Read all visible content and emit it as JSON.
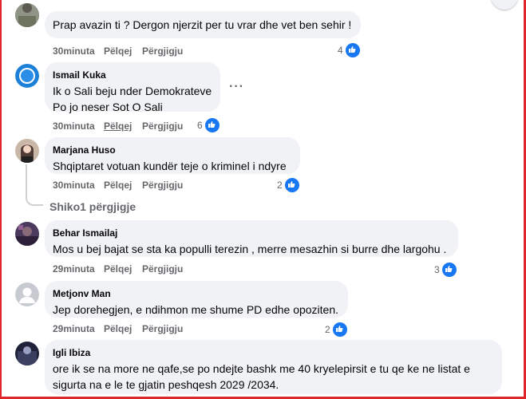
{
  "comments": [
    {
      "author": "",
      "lines": [
        "Prap avazin ti ? Dergon njerzit per tu vrar dhe vet ben sehir !"
      ],
      "time": "30minuta",
      "like": "Pëlqej",
      "reply": "Përgjigju",
      "reactions": "4"
    },
    {
      "author": "Ismail Kuka",
      "lines": [
        "Ik o Sali beju nder Demokrateve",
        "Po jo neser Sot O Sali"
      ],
      "time": "30minuta",
      "like": "Pëlqej",
      "reply": "Përgjigju",
      "reactions": "6"
    },
    {
      "author": "Marjana Huso",
      "lines": [
        "Shqiptaret votuan kundër teje o kriminel i ndyre"
      ],
      "time": "30minuta",
      "like": "Pëlqej",
      "reply": "Përgjigju",
      "reactions": "2"
    },
    {
      "author": "Behar Ismailaj",
      "lines": [
        "Mos u bej bajat se sta ka populli terezin , merre mesazhin si burre dhe largohu ."
      ],
      "time": "29minuta",
      "like": "Pëlqej",
      "reply": "Përgjigju",
      "reactions": "3"
    },
    {
      "author": "Metjonv Man",
      "lines": [
        "Jep dorehegjen, e ndihmon me shume PD edhe opoziten."
      ],
      "time": "29minuta",
      "like": "Pëlqej",
      "reply": "Përgjigju",
      "reactions": "2"
    },
    {
      "author": "Igli Ibiza",
      "lines": [
        "ore ik se na more ne qafe,se po ndejte bashk me 40 kryelepirsit e tu qe ke ne listat e",
        "sigurta na e le te gjatin peshqesh 2029 /2034."
      ]
    }
  ],
  "view_replies": "Shiko1 përgjigje",
  "colors": {
    "accent": "#1877f2",
    "bubble": "#f0f2f5",
    "frame": "#e0262b"
  }
}
